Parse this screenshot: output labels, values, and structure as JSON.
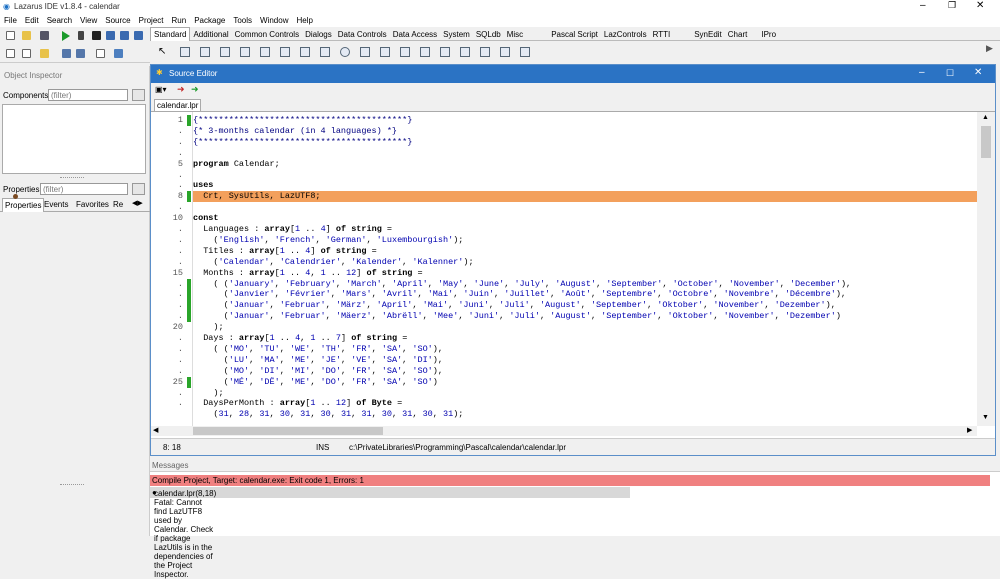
{
  "app": {
    "title": "Lazarus IDE v1.8.4 - calendar"
  },
  "menu": [
    "File",
    "Edit",
    "Search",
    "View",
    "Source",
    "Project",
    "Run",
    "Package",
    "Tools",
    "Window",
    "Help"
  ],
  "palette_tabs": [
    "Standard",
    "Additional",
    "Common Controls",
    "Dialogs",
    "Data Controls",
    "Data Access",
    "System",
    "SQLdb",
    "Misc",
    "Pascal Script",
    "LazControls",
    "RTTI",
    "SynEdit",
    "Chart",
    "IPro"
  ],
  "object_inspector": {
    "title": "Object Inspector",
    "components_label": "Components",
    "components_filter": "(filter)",
    "properties_label": "Properties",
    "properties_filter": "(filter)",
    "tabs": [
      "Properties",
      "Events",
      "Favorites",
      "Re"
    ]
  },
  "editor": {
    "title": "Source Editor",
    "tab": "calendar.lpr",
    "status_pos": "8: 18",
    "status_mode": "INS",
    "status_path": "c:\\PrivateLibraries\\Programming\\Pascal\\calendar\\calendar.lpr",
    "line_numbers": [
      "1",
      ".",
      ".",
      ".",
      "5",
      ".",
      ".",
      "8",
      ".",
      "10",
      ".",
      ".",
      ".",
      ".",
      "15",
      ".",
      ".",
      ".",
      ".",
      "20",
      ".",
      ".",
      ".",
      ".",
      "25",
      ".",
      "."
    ],
    "lines": [
      "{*****************************************}",
      "{* 3-months calendar (in 4 languages) *}",
      "{*****************************************}",
      "",
      "program Calendar;",
      "",
      "uses",
      "  Crt, SysUtils, LazUTF8;",
      "",
      "const",
      "  Languages : array[1 .. 4] of string =",
      "    ('English', 'French', 'German', 'Luxembourgish');",
      "  Titles : array[1 .. 4] of string =",
      "    ('Calendar', 'Calendrier', 'Kalender', 'Kalenner');",
      "  Months : array[1 .. 4, 1 .. 12] of string =",
      "    ( ('January', 'February', 'March', 'April', 'May', 'June', 'July', 'August', 'September', 'October', 'November', 'December'),",
      "      ('Janvier', 'Février', 'Mars', 'Avril', 'Mai', 'Juin', 'Juillet', 'Août', 'Septembre', 'Octobre', 'Novembre', 'Décembre'),",
      "      ('Januar', 'Februar', 'März', 'April', 'Mai', 'Juni', 'Juli', 'August', 'September', 'Oktober', 'November', 'Dezember'),",
      "      ('Januar', 'Februar', 'Mäerz', 'Abrëll', 'Mee', 'Juni', 'Juli', 'August', 'September', 'Oktober', 'November', 'Dezember')",
      "    );",
      "  Days : array[1 .. 4, 1 .. 7] of string =",
      "    ( ('MO', 'TU', 'WE', 'TH', 'FR', 'SA', 'SO'),",
      "      ('LU', 'MA', 'ME', 'JE', 'VE', 'SA', 'DI'),",
      "      ('MO', 'DI', 'MI', 'DO', 'FR', 'SA', 'SO'),",
      "      ('MÉ', 'DË', 'ME', 'DO', 'FR', 'SA', 'SO')",
      "    );",
      "  DaysPerMonth : array[1 .. 12] of Byte =",
      "    (31, 28, 31, 30, 31, 30, 31, 31, 30, 31, 30, 31);"
    ]
  },
  "messages": {
    "title": "Messages",
    "line1": "Compile Project, Target: calendar.exe: Exit code 1, Errors: 1",
    "line2": "calendar.lpr(8,18) Fatal: Cannot find LazUTF8 used by Calendar. Check if package LazUtils is in the dependencies of the Project Inspector."
  },
  "colors": {
    "accent": "#2b73c4",
    "highlight": "#f3a05c",
    "error": "#f08080"
  }
}
